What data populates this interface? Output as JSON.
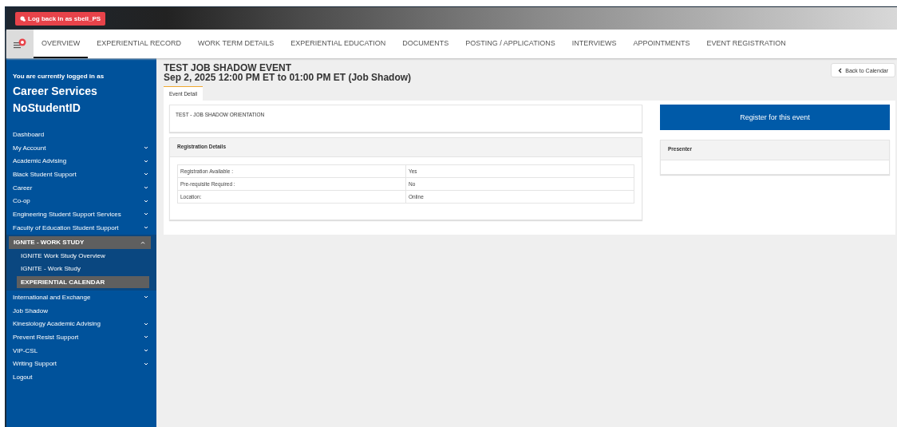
{
  "banner": {
    "login_back_button": "Log back in as sbell_PS"
  },
  "nav": {
    "tabs": [
      {
        "label": "OVERVIEW",
        "selected": true
      },
      {
        "label": "EXPERIENTIAL RECORD",
        "selected": false
      },
      {
        "label": "WORK TERM DETAILS",
        "selected": false
      },
      {
        "label": "EXPERIENTIAL EDUCATION",
        "selected": false
      },
      {
        "label": "DOCUMENTS",
        "selected": false
      },
      {
        "label": "POSTING / APPLICATIONS",
        "selected": false
      },
      {
        "label": "INTERVIEWS",
        "selected": false
      },
      {
        "label": "APPOINTMENTS",
        "selected": false
      },
      {
        "label": "EVENT REGISTRATION",
        "selected": false
      }
    ]
  },
  "sidebar": {
    "logged_in_label": "You are currently logged in as",
    "user_name": "Career Services NoStudentID",
    "items": [
      {
        "label": "Dashboard",
        "kind": "link"
      },
      {
        "label": "My Account",
        "kind": "group",
        "expanded": false
      },
      {
        "label": "Academic Advising",
        "kind": "group",
        "expanded": false
      },
      {
        "label": "Black Student Support",
        "kind": "group",
        "expanded": false
      },
      {
        "label": "Career",
        "kind": "group",
        "expanded": false
      },
      {
        "label": "Co-op",
        "kind": "group",
        "expanded": false
      },
      {
        "label": "Engineering Student Support Services",
        "kind": "group",
        "expanded": false
      },
      {
        "label": "Faculty of Education Student Support",
        "kind": "group",
        "expanded": false
      },
      {
        "label": "IGNITE - WORK STUDY",
        "kind": "group",
        "expanded": true,
        "children": [
          {
            "label": "IGNITE Work Study Overview",
            "selected": false
          },
          {
            "label": "IGNITE - Work Study",
            "selected": false
          },
          {
            "label": "EXPERIENTIAL CALENDAR",
            "selected": true
          }
        ]
      },
      {
        "label": "International and Exchange",
        "kind": "group",
        "expanded": false
      },
      {
        "label": "Job Shadow",
        "kind": "link"
      },
      {
        "label": "Kinesiology Academic Advising",
        "kind": "group",
        "expanded": false
      },
      {
        "label": "Prevent Resist Support",
        "kind": "group",
        "expanded": false
      },
      {
        "label": "VIP-CSL",
        "kind": "group",
        "expanded": false
      },
      {
        "label": "Writing Support",
        "kind": "group",
        "expanded": false
      },
      {
        "label": "Logout",
        "kind": "link"
      }
    ]
  },
  "event": {
    "title": "TEST JOB SHADOW EVENT",
    "when": "Sep 2, 2025 12:00 PM ET to 01:00 PM ET (Job Shadow)",
    "back_button": "Back to Calendar",
    "tabs": [
      {
        "label": "Event Detail",
        "selected": true
      }
    ],
    "description": "TEST - JOB SHADOW ORIENTATION",
    "registration_details": {
      "title": "Registration Details",
      "rows": [
        {
          "label": "Registration Available :",
          "value": "Yes"
        },
        {
          "label": "Pre-requisite Required :",
          "value": "No"
        },
        {
          "label": "Location:",
          "value": "Online"
        }
      ]
    },
    "register_button": "Register for this event",
    "presenter": {
      "title": "Presenter"
    }
  }
}
